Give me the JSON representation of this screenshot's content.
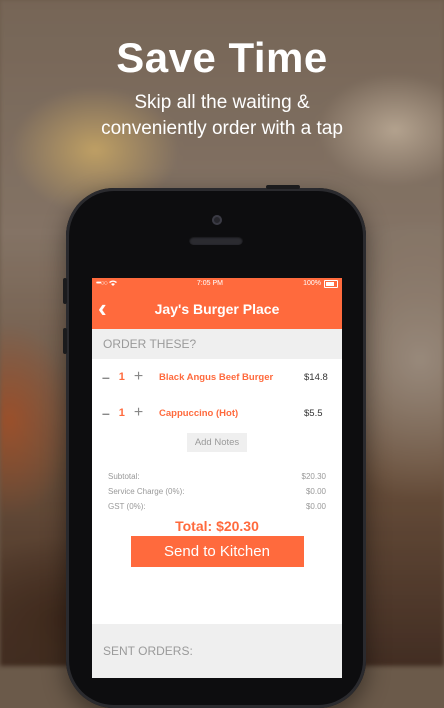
{
  "hero": {
    "title": "Save Time",
    "subtitle_line1": "Skip all the waiting &",
    "subtitle_line2": "conveniently order with a tap"
  },
  "status_bar": {
    "signal": "•••○○",
    "time": "7:05 PM",
    "battery": "100%"
  },
  "nav": {
    "back_icon": "chevron-left-icon",
    "title": "Jay's Burger Place"
  },
  "order": {
    "section_title": "ORDER THESE?",
    "items": [
      {
        "qty": "1",
        "name": "Black Angus Beef Burger",
        "price": "$14.8"
      },
      {
        "qty": "1",
        "name": "Cappuccino (Hot)",
        "price": "$5.5"
      }
    ],
    "add_notes": "Add Notes",
    "summary": [
      {
        "label": "Subtotal:",
        "value": "$20.30"
      },
      {
        "label": "Service Charge (0%):",
        "value": "$0.00"
      },
      {
        "label": "GST (0%):",
        "value": "$0.00"
      }
    ],
    "total": "Total: $20.30",
    "send_button": "Send to Kitchen"
  },
  "sent": {
    "section_title": "SENT ORDERS:"
  },
  "colors": {
    "accent": "#ff6a3d"
  }
}
